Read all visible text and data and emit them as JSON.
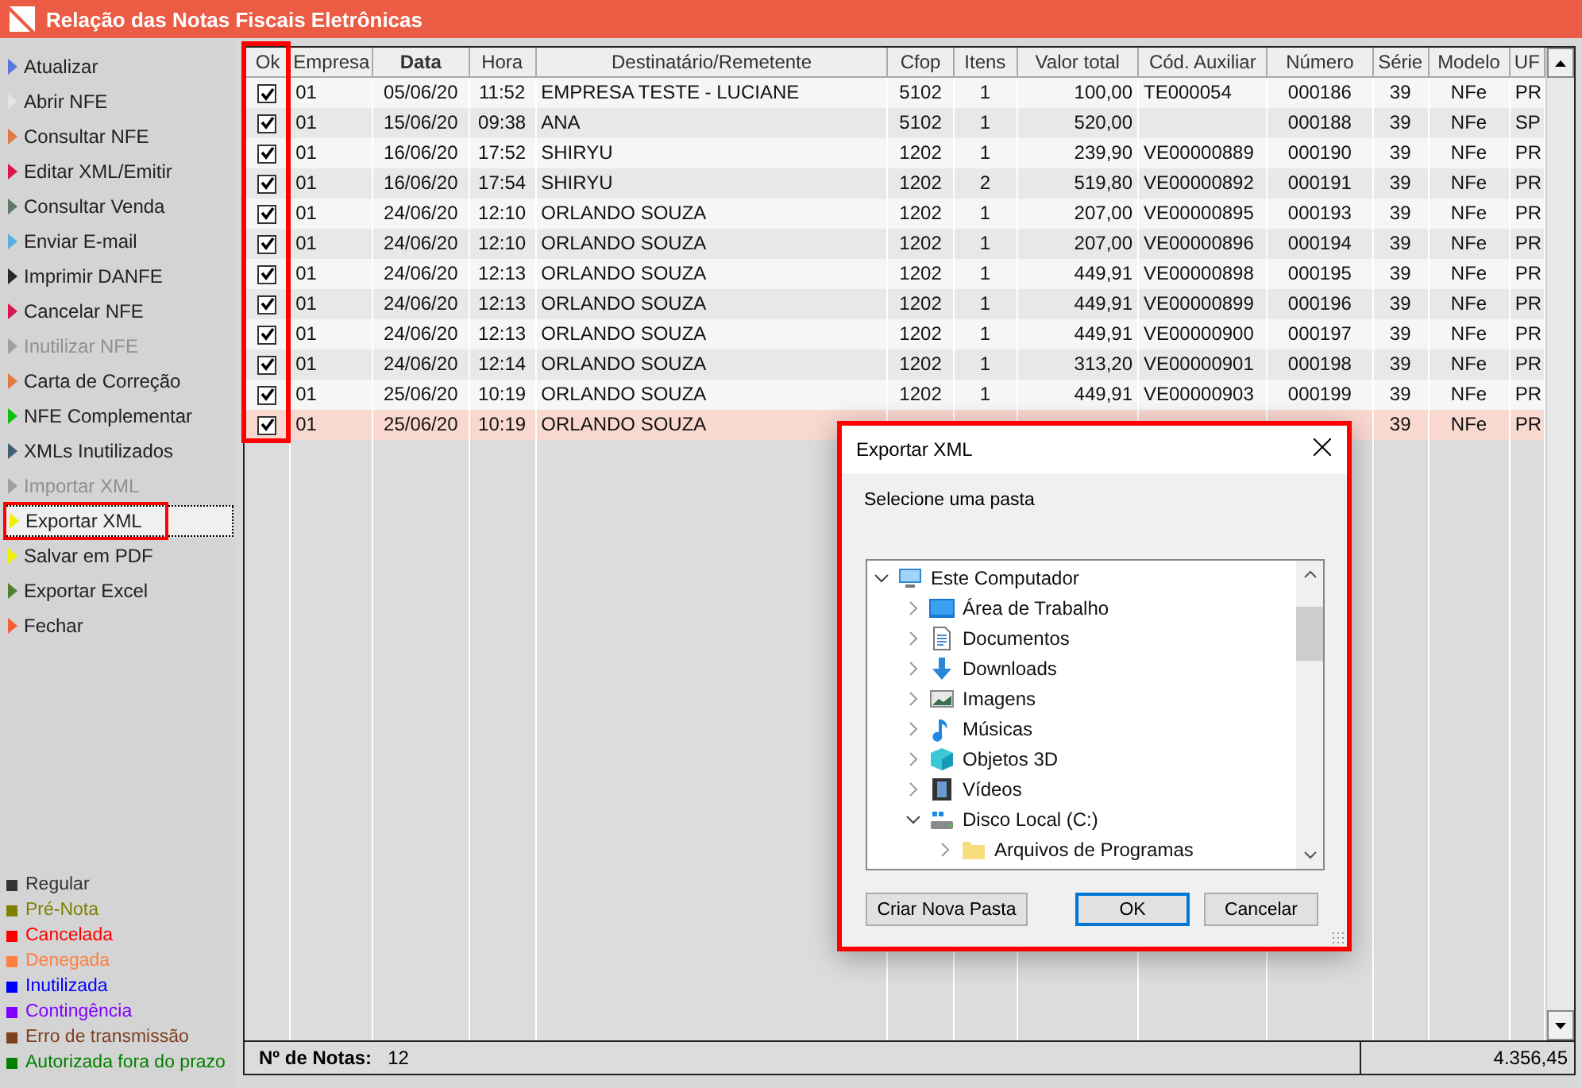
{
  "window": {
    "title": "Relação das Notas Fiscais Eletrônicas"
  },
  "sidebar": {
    "items": [
      {
        "label": "Atualizar",
        "color": "#5a78d8",
        "disabled": false,
        "selected": false
      },
      {
        "label": "Abrir NFE",
        "color": "#e4e4e4",
        "disabled": false,
        "selected": false
      },
      {
        "label": "Consultar NFE",
        "color": "#e07a40",
        "disabled": false,
        "selected": false
      },
      {
        "label": "Editar XML/Emitir",
        "color": "#d81850",
        "disabled": false,
        "selected": false
      },
      {
        "label": "Consultar Venda",
        "color": "#607868",
        "disabled": false,
        "selected": false
      },
      {
        "label": "Enviar E-mail",
        "color": "#58b0e0",
        "disabled": false,
        "selected": false
      },
      {
        "label": "Imprimir DANFE",
        "color": "#282828",
        "disabled": false,
        "selected": false
      },
      {
        "label": "Cancelar NFE",
        "color": "#d81850",
        "disabled": false,
        "selected": false
      },
      {
        "label": "Inutilizar NFE",
        "color": "#a0a0a0",
        "disabled": true,
        "selected": false
      },
      {
        "label": "Carta de Correção",
        "color": "#e07a40",
        "disabled": false,
        "selected": false
      },
      {
        "label": "NFE Complementar",
        "color": "#10c010",
        "disabled": false,
        "selected": false
      },
      {
        "label": "XMLs Inutilizados",
        "color": "#406078",
        "disabled": false,
        "selected": false
      },
      {
        "label": "Importar XML",
        "color": "#a0a0a0",
        "disabled": true,
        "selected": false
      },
      {
        "label": "Exportar XML",
        "color": "#f0f000",
        "disabled": false,
        "selected": true
      },
      {
        "label": "Salvar em PDF",
        "color": "#f0f000",
        "disabled": false,
        "selected": false
      },
      {
        "label": "Exportar Excel",
        "color": "#508030",
        "disabled": false,
        "selected": false
      },
      {
        "label": "Fechar",
        "color": "#f06030",
        "disabled": false,
        "selected": false
      }
    ]
  },
  "legend": [
    {
      "label": "Regular",
      "color": "#333333"
    },
    {
      "label": "Pré-Nota",
      "color": "#808000"
    },
    {
      "label": "Cancelada",
      "color": "#ff0000"
    },
    {
      "label": "Denegada",
      "color": "#ff8040"
    },
    {
      "label": "Inutilizada",
      "color": "#0000ff"
    },
    {
      "label": "Contingência",
      "color": "#8000ff"
    },
    {
      "label": "Erro de transmissão",
      "color": "#804020"
    },
    {
      "label": "Autorizada fora do prazo",
      "color": "#008000"
    }
  ],
  "table": {
    "check_column": "Ok",
    "columns": [
      "Empresa",
      "Data",
      "Hora",
      "Destinatário/Remetente",
      "Cfop",
      "Itens",
      "Valor total",
      "Cód. Auxiliar",
      "Número",
      "Série",
      "Modelo",
      "UF"
    ],
    "rows": [
      {
        "checked": true,
        "selected": false,
        "cells": [
          "01",
          "05/06/20",
          "11:52",
          "EMPRESA TESTE - LUCIANE",
          "5102",
          "1",
          "100,00",
          "TE000054",
          "000186",
          "39",
          "NFe",
          "PR"
        ]
      },
      {
        "checked": true,
        "selected": false,
        "cells": [
          "01",
          "15/06/20",
          "09:38",
          "ANA",
          "5102",
          "1",
          "520,00",
          null,
          "000188",
          "39",
          "NFe",
          "SP"
        ]
      },
      {
        "checked": true,
        "selected": false,
        "cells": [
          "01",
          "16/06/20",
          "17:52",
          "SHIRYU",
          "1202",
          "1",
          "239,90",
          "VE00000889",
          "000190",
          "39",
          "NFe",
          "PR"
        ]
      },
      {
        "checked": true,
        "selected": false,
        "cells": [
          "01",
          "16/06/20",
          "17:54",
          "SHIRYU",
          "1202",
          "2",
          "519,80",
          "VE00000892",
          "000191",
          "39",
          "NFe",
          "PR"
        ]
      },
      {
        "checked": true,
        "selected": false,
        "cells": [
          "01",
          "24/06/20",
          "12:10",
          "ORLANDO SOUZA",
          "1202",
          "1",
          "207,00",
          "VE00000895",
          "000193",
          "39",
          "NFe",
          "PR"
        ]
      },
      {
        "checked": true,
        "selected": false,
        "cells": [
          "01",
          "24/06/20",
          "12:10",
          "ORLANDO SOUZA",
          "1202",
          "1",
          "207,00",
          "VE00000896",
          "000194",
          "39",
          "NFe",
          "PR"
        ]
      },
      {
        "checked": true,
        "selected": false,
        "cells": [
          "01",
          "24/06/20",
          "12:13",
          "ORLANDO SOUZA",
          "1202",
          "1",
          "449,91",
          "VE00000898",
          "000195",
          "39",
          "NFe",
          "PR"
        ]
      },
      {
        "checked": true,
        "selected": false,
        "cells": [
          "01",
          "24/06/20",
          "12:13",
          "ORLANDO SOUZA",
          "1202",
          "1",
          "449,91",
          "VE00000899",
          "000196",
          "39",
          "NFe",
          "PR"
        ]
      },
      {
        "checked": true,
        "selected": false,
        "cells": [
          "01",
          "24/06/20",
          "12:13",
          "ORLANDO SOUZA",
          "1202",
          "1",
          "449,91",
          "VE00000900",
          "000197",
          "39",
          "NFe",
          "PR"
        ]
      },
      {
        "checked": true,
        "selected": false,
        "cells": [
          "01",
          "24/06/20",
          "12:14",
          "ORLANDO SOUZA",
          "1202",
          "1",
          "313,20",
          "VE00000901",
          "000198",
          "39",
          "NFe",
          "PR"
        ]
      },
      {
        "checked": true,
        "selected": false,
        "cells": [
          "01",
          "25/06/20",
          "10:19",
          "ORLANDO SOUZA",
          "1202",
          "1",
          "449,91",
          "VE00000903",
          "000199",
          "39",
          "NFe",
          "PR"
        ]
      },
      {
        "checked": true,
        "selected": true,
        "cells": [
          "01",
          "25/06/20",
          "10:19",
          "ORLANDO SOUZA",
          null,
          null,
          null,
          null,
          null,
          "39",
          "NFe",
          "PR"
        ]
      }
    ]
  },
  "status_bar": {
    "label": "Nº de Notas:",
    "count": "12",
    "total": "4.356,45"
  },
  "dialog": {
    "title": "Exportar XML",
    "prompt": "Selecione uma pasta",
    "tree": [
      {
        "label": "Este Computador",
        "kind": "computer",
        "expanded": true,
        "children": [
          {
            "label": "Área de Trabalho",
            "kind": "desktop",
            "expanded": false
          },
          {
            "label": "Documentos",
            "kind": "documents",
            "expanded": false
          },
          {
            "label": "Downloads",
            "kind": "downloads",
            "expanded": false
          },
          {
            "label": "Imagens",
            "kind": "images",
            "expanded": false
          },
          {
            "label": "Músicas",
            "kind": "music",
            "expanded": false
          },
          {
            "label": "Objetos 3D",
            "kind": "objects",
            "expanded": false
          },
          {
            "label": "Vídeos",
            "kind": "videos",
            "expanded": false
          },
          {
            "label": "Disco Local (C:)",
            "kind": "drive",
            "expanded": true,
            "children": [
              {
                "label": "Arquivos de Programas",
                "kind": "folder",
                "expanded": false
              }
            ]
          }
        ]
      }
    ],
    "buttons": [
      {
        "label": "Criar Nova Pasta",
        "selected": false
      },
      {
        "label": "OK",
        "selected": true
      },
      {
        "label": "Cancelar",
        "selected": false
      }
    ]
  }
}
